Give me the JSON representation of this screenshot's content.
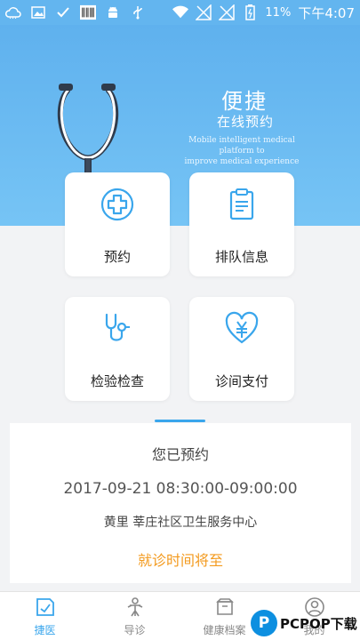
{
  "status_bar": {
    "battery": "11%",
    "time": "下午4:07"
  },
  "hero": {
    "title": "便捷",
    "subtitle": "在线预约",
    "english_line1": "Mobile intelligent medical platform to",
    "english_line2": "improve medical experience"
  },
  "features": [
    {
      "label": "预约",
      "icon": "medical-cross-icon"
    },
    {
      "label": "排队信息",
      "icon": "clipboard-icon"
    },
    {
      "label": "检验检查",
      "icon": "stethoscope-icon"
    },
    {
      "label": "诊间支付",
      "icon": "yuan-heart-icon"
    }
  ],
  "appointment": {
    "title": "您已预约",
    "time": "2017-09-21 08:30:00-09:00:00",
    "place": "黄里 莘庄社区卫生服务中心",
    "status": "就诊时间将至"
  },
  "tabs": [
    {
      "label": "捷医",
      "icon": "home-doc-icon",
      "active": true
    },
    {
      "label": "导诊",
      "icon": "guide-icon",
      "active": false
    },
    {
      "label": "健康档案",
      "icon": "archive-icon",
      "active": false
    },
    {
      "label": "我的",
      "icon": "profile-icon",
      "active": false
    }
  ],
  "watermark": {
    "letter": "P",
    "text": "PCPOP下载"
  },
  "colors": {
    "primary": "#3aa6ec",
    "hero_blue": "#63b5ef",
    "accent_orange": "#f39a1e"
  }
}
